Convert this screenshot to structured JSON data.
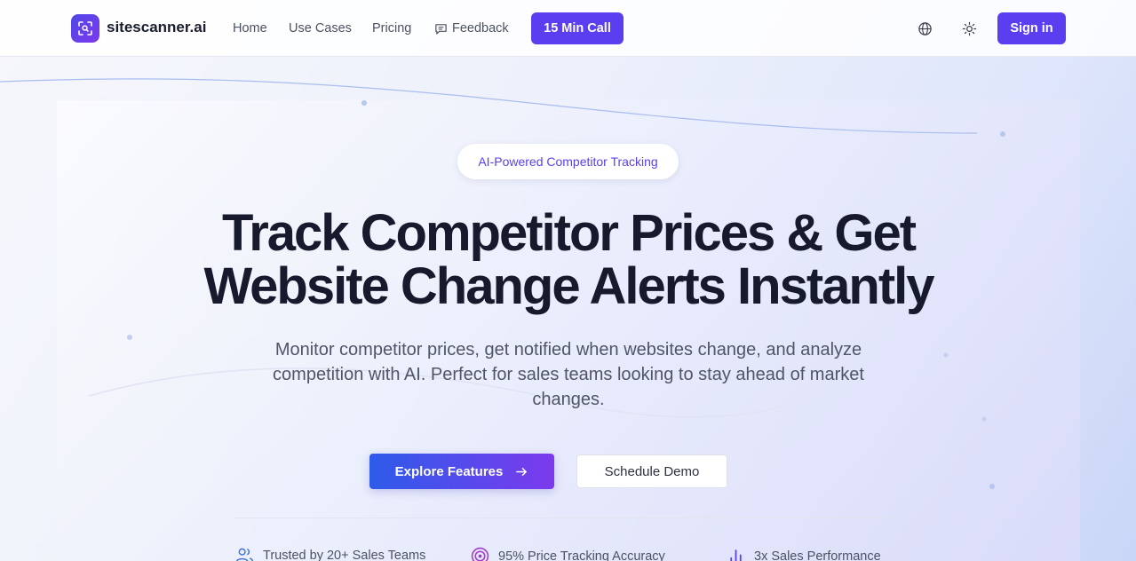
{
  "brand": {
    "name": "sitescanner.ai",
    "logo_icon": "scan-search-icon"
  },
  "nav": {
    "links": [
      "Home",
      "Use Cases",
      "Pricing"
    ],
    "feedback_label": "Feedback",
    "call_label": "15 Min Call",
    "signin_label": "Sign in"
  },
  "hero": {
    "badge": "AI-Powered Competitor Tracking",
    "headline_line1": "Track Competitor Prices & Get",
    "headline_line2": "Website Change Alerts Instantly",
    "subtext": "Monitor competitor prices, get notified when websites change, and analyze competition with AI. Perfect for sales teams looking to stay ahead of market changes.",
    "explore_label": "Explore Features",
    "demo_label": "Schedule Demo"
  },
  "stats": [
    {
      "label": "Trusted by 20+ Sales Teams",
      "icon": "users-icon"
    },
    {
      "label": "95% Price Tracking Accuracy",
      "icon": "target-icon"
    },
    {
      "label": "3x Sales Performance",
      "icon": "bar-chart-icon"
    }
  ],
  "colors": {
    "primary": "#5b3ef0",
    "gradient_start": "#2d5bea",
    "gradient_end": "#7c3aed",
    "heading": "#161a2c"
  }
}
